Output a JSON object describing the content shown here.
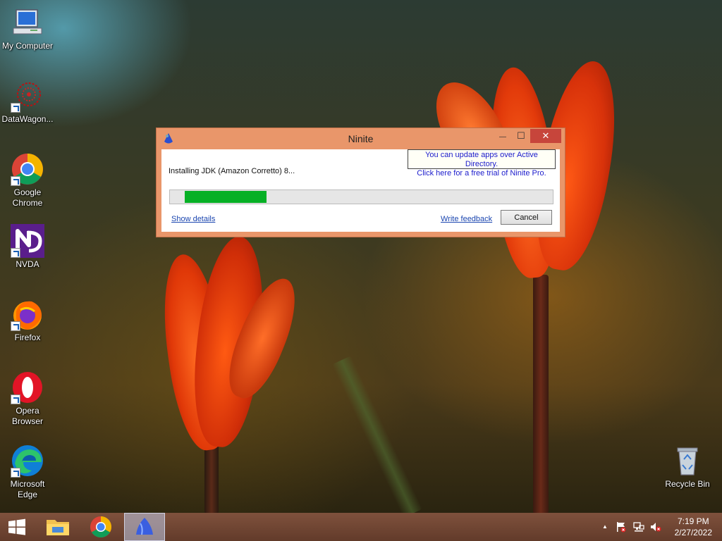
{
  "desktop": {
    "icons": [
      {
        "label": "My Computer"
      },
      {
        "label": "DataWagon..."
      },
      {
        "label": "Google Chrome"
      },
      {
        "label": "NVDA"
      },
      {
        "label": "Firefox"
      },
      {
        "label": "Opera Browser"
      },
      {
        "label": "Microsoft Edge"
      },
      {
        "label": "Recycle Bin"
      }
    ]
  },
  "ninite": {
    "title": "Ninite",
    "close_glyph": "✕",
    "minimize_glyph": "—",
    "maximize_glyph": "☐",
    "promo_line1": "You can update apps over Active Directory.",
    "promo_line2": "Click here for a free trial of Ninite Pro.",
    "status": "Installing JDK (Amazon Corretto) 8...",
    "progress_fraction": 0.23,
    "show_details": "Show details",
    "write_feedback": "Write feedback",
    "cancel": "Cancel"
  },
  "taskbar": {
    "time": "7:19 PM",
    "date": "2/27/2022",
    "tray_up_glyph": "▲"
  },
  "colors": {
    "progress_fill": "#06b025",
    "title_bar": "#e9966a",
    "close_button": "#c7453b"
  }
}
